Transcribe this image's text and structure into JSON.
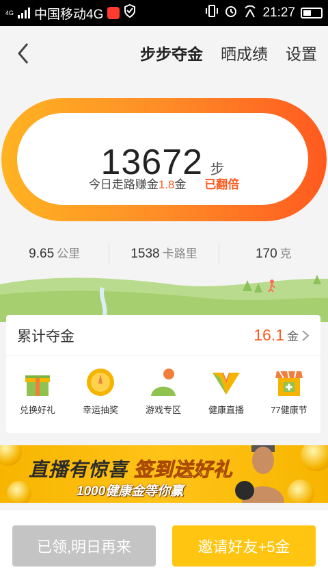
{
  "status_bar": {
    "carrier": "中国移动4G",
    "network_badge": "4G",
    "time": "21:27"
  },
  "header": {
    "tabs": [
      "步步夺金",
      "晒成绩",
      "设置"
    ]
  },
  "steps": {
    "count": "13672",
    "unit": "步",
    "earn_prefix": "今日走路赚金",
    "earn_value": "1.8",
    "earn_unit": "金",
    "doubled": "已翻倍"
  },
  "stats": {
    "distance_value": "9.65",
    "distance_unit": "公里",
    "calories_value": "1538",
    "calories_unit": "卡路里",
    "fat_value": "170",
    "fat_unit": "克"
  },
  "accumulated": {
    "title": "累计夺金",
    "value": "16.1",
    "unit": "金"
  },
  "features": [
    {
      "label": "兑换好礼",
      "icon": "gift-icon"
    },
    {
      "label": "幸运抽奖",
      "icon": "lottery-dial-icon"
    },
    {
      "label": "游戏专区",
      "icon": "game-icon"
    },
    {
      "label": "健康直播",
      "icon": "live-v-icon"
    },
    {
      "label": "77健康节",
      "icon": "shop-icon"
    }
  ],
  "banner": {
    "line1_a": "直播有惊喜",
    "line1_b": "签到送好礼",
    "line2": "1000健康金等你赢"
  },
  "buttons": {
    "claimed": "已领,明日再来",
    "invite": "邀请好友+5金"
  },
  "colors": {
    "accent_orange": "#ff5a1f",
    "ring_start": "#ffb322",
    "ring_end": "#ff5a1f",
    "button_yellow": "#ffc510",
    "button_gray": "#c4c4c4"
  }
}
